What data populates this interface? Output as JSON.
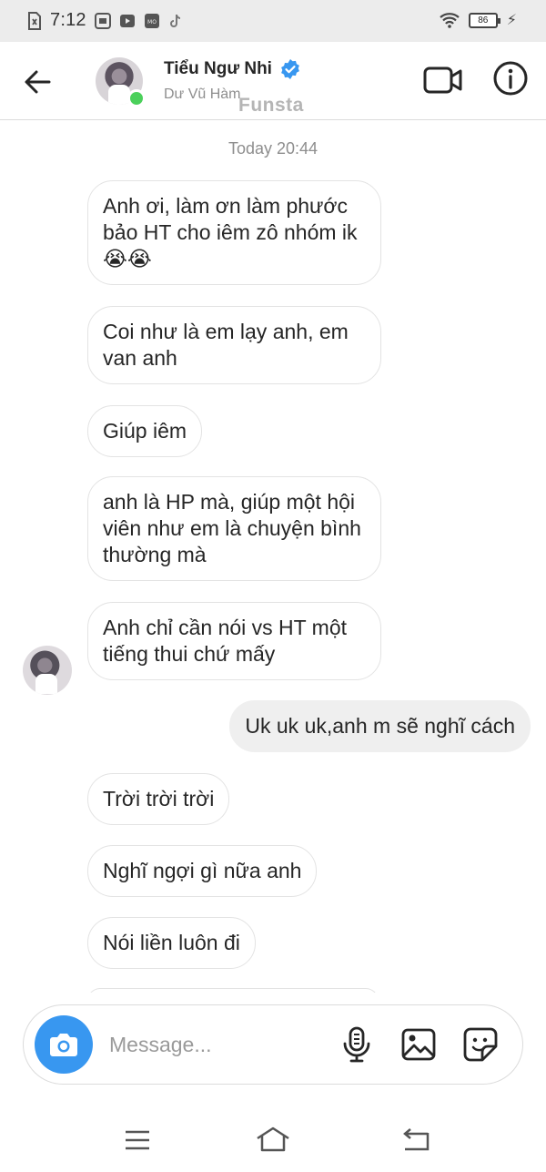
{
  "status_bar": {
    "time": "7:12",
    "battery": "86"
  },
  "header": {
    "name": "Tiểu Ngư Nhi",
    "subtitle": "Dư Vũ Hàm",
    "watermark": "Funsta",
    "online": true
  },
  "chat": {
    "timestamp": "Today 20:44",
    "messages": [
      {
        "dir": "in",
        "text": "Anh ơi, làm ơn làm phước bảo HT cho iêm zô nhóm ik 😭😭"
      },
      {
        "dir": "in",
        "text": "Coi như là em lạy anh, em van anh"
      },
      {
        "dir": "in",
        "text": "Giúp iêm"
      },
      {
        "dir": "in",
        "text": "anh là HP mà, giúp một hội viên như em là chuyện bình thường mà"
      },
      {
        "dir": "in",
        "text": "Anh chỉ cần nói vs HT một tiếng thui chứ mấy"
      },
      {
        "dir": "out",
        "text": "Uk uk uk,anh m sẽ nghĩ cách"
      },
      {
        "dir": "in",
        "text": "Trời trời trời"
      },
      {
        "dir": "in",
        "text": "Nghĩ ngợi gì nữa anh"
      },
      {
        "dir": "in",
        "text": "Nói liền luôn đi"
      }
    ]
  },
  "composer": {
    "placeholder": "Message..."
  },
  "colors": {
    "accent": "#3897f0",
    "online": "#4bd05b",
    "verified": "#3897f0",
    "outgoing_bubble": "#efefef"
  },
  "icons": [
    "back-arrow-icon",
    "verified-badge-icon",
    "video-call-icon",
    "info-icon",
    "camera-icon",
    "microphone-icon",
    "gallery-icon",
    "sticker-icon",
    "nav-menu-icon",
    "nav-home-icon",
    "nav-back-icon"
  ]
}
